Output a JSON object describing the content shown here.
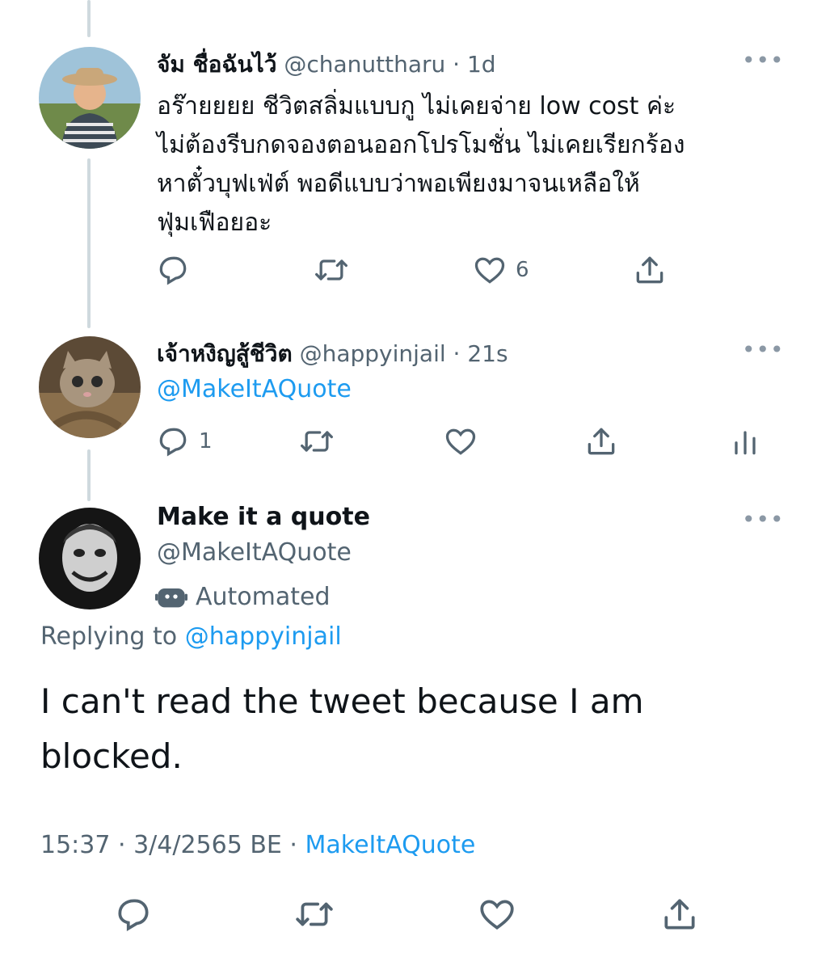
{
  "tweet1": {
    "display_name": "จัม ชื่อฉันไว้",
    "handle_time": "@chanuttharu · 1d",
    "text_lines": [
      "อร๊ายยยย ชีวิตสลิ่มแบบกู ไม่เคยจ่าย low cost ค่ะ",
      "ไม่ต้องรีบกดจองตอนออกโปรโมชั่น ไม่เคยเรียกร้อง",
      "หาตั๋วบุฟเฟ่ต์ พอดีแบบว่าพอเพียงมาจนเหลือให้",
      "ฟุ่มเฟือยอะ"
    ],
    "like_count": "6"
  },
  "tweet2": {
    "display_name": "เจ้าหงิญสู้ชีวิต",
    "handle_time": "@happyinjail · 21s",
    "text": "@MakeItAQuote",
    "reply_count": "1"
  },
  "tweet3": {
    "display_name": "Make it a quote",
    "handle": "@MakeItAQuote",
    "automated_label": "Automated",
    "replying_prefix": "Replying to",
    "replying_handle": "@happyinjail",
    "text_lines": [
      "I can't read the tweet because I am",
      "blocked."
    ],
    "timestamp": "15:37 · 3/4/2565 BE ·",
    "source": "MakeItAQuote"
  },
  "icons": {
    "reply": "reply-icon",
    "retweet": "retweet-icon",
    "like": "heart-icon",
    "share": "share-icon",
    "analytics": "analytics-icon",
    "more": "more-icon",
    "bot": "bot-icon"
  },
  "colors": {
    "accent": "#1d9bf0",
    "muted": "#536471",
    "thread_line": "#cfd9de"
  }
}
